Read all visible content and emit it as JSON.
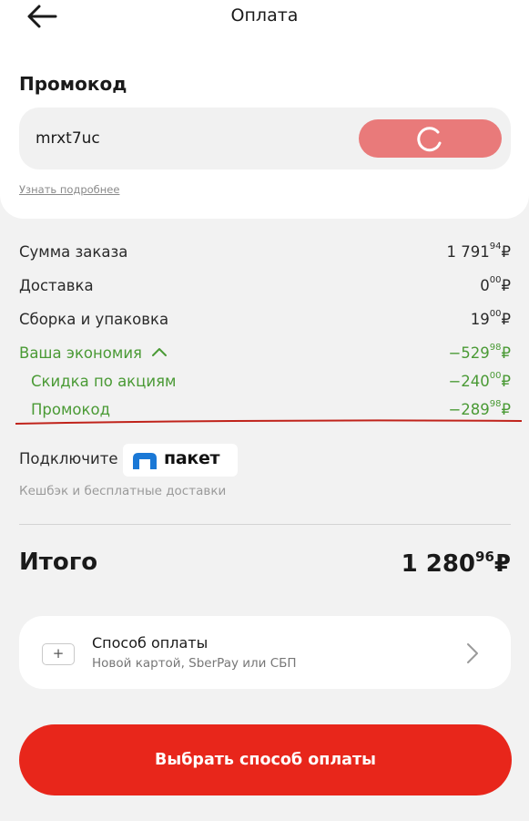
{
  "header": {
    "title": "Оплата"
  },
  "promo": {
    "heading": "Промокод",
    "input_value": "mrxt7uc",
    "learn_more": "Узнать подробнее",
    "button_color": "#e97a7a"
  },
  "summary": {
    "rows": [
      {
        "label": "Сумма заказа",
        "value_main": "1 791",
        "value_cents": "94",
        "currency": "₽"
      },
      {
        "label": "Доставка",
        "value_main": "0",
        "value_cents": "00",
        "currency": "₽"
      },
      {
        "label": "Сборка и упаковка",
        "value_main": "19",
        "value_cents": "00",
        "currency": "₽"
      },
      {
        "label": "Ваша экономия",
        "value_main": "−529",
        "value_cents": "98",
        "currency": "₽"
      },
      {
        "label": "Скидка по акциям",
        "value_main": "−240",
        "value_cents": "00",
        "currency": "₽"
      },
      {
        "label": "Промокод",
        "value_main": "−289",
        "value_cents": "98",
        "currency": "₽"
      }
    ],
    "savings_color": "#4a9a35",
    "annotation_line_color": "#c0231b"
  },
  "paket": {
    "connect_label": "Подключите",
    "logo_text": "пакет",
    "cashback_text": "Кешбэк и бесплатные доставки",
    "logo_icon": "paket-logo-icon"
  },
  "total": {
    "label": "Итого",
    "value_main": "1 280",
    "value_cents": "96",
    "currency": "₽"
  },
  "payment": {
    "title": "Способ оплаты",
    "subtitle": "Новой картой, SberPay или СБП",
    "plus_icon": "+"
  },
  "cta": {
    "label": "Выбрать способ оплаты",
    "color": "#e8261b"
  }
}
